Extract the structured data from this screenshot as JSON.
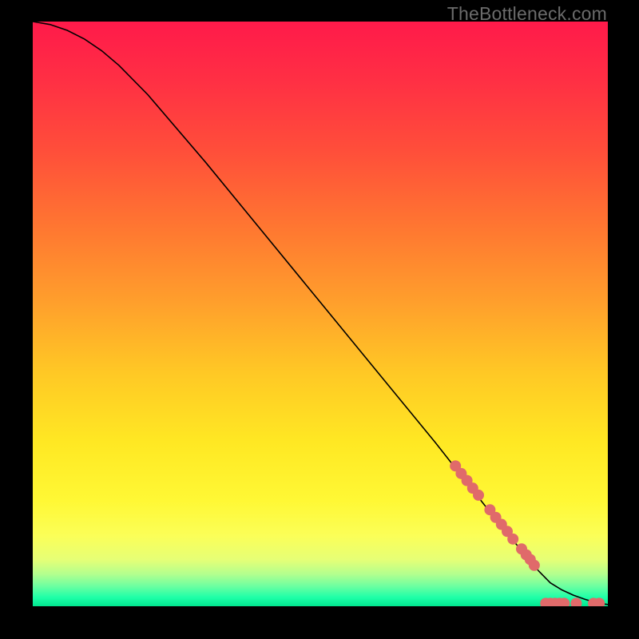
{
  "watermark": "TheBottleneck.com",
  "gradient_stops": [
    {
      "offset": 0.0,
      "color": "#ff1a4a"
    },
    {
      "offset": 0.1,
      "color": "#ff2f44"
    },
    {
      "offset": 0.22,
      "color": "#ff4e3a"
    },
    {
      "offset": 0.35,
      "color": "#ff7631"
    },
    {
      "offset": 0.48,
      "color": "#ff9f2c"
    },
    {
      "offset": 0.6,
      "color": "#ffc825"
    },
    {
      "offset": 0.72,
      "color": "#ffe823"
    },
    {
      "offset": 0.82,
      "color": "#fff835"
    },
    {
      "offset": 0.88,
      "color": "#fbff58"
    },
    {
      "offset": 0.92,
      "color": "#e6ff76"
    },
    {
      "offset": 0.945,
      "color": "#b3ff8e"
    },
    {
      "offset": 0.965,
      "color": "#6fffa0"
    },
    {
      "offset": 0.985,
      "color": "#1effa8"
    },
    {
      "offset": 1.0,
      "color": "#00e68f"
    }
  ],
  "chart_data": {
    "type": "line",
    "title": "",
    "xlabel": "",
    "ylabel": "",
    "xlim": [
      0,
      100
    ],
    "ylim": [
      0,
      100
    ],
    "series": [
      {
        "name": "curve",
        "x": [
          0,
          3,
          6,
          9,
          12,
          15,
          20,
          30,
          40,
          50,
          60,
          70,
          80,
          85,
          88,
          90,
          92,
          94,
          96,
          98,
          100
        ],
        "y": [
          100,
          99.5,
          98.5,
          97,
          95,
          92.5,
          87.5,
          76,
          64,
          52,
          40,
          28,
          15.5,
          9.5,
          6,
          4,
          2.8,
          1.9,
          1.2,
          0.6,
          0.3
        ]
      }
    ],
    "markers": [
      {
        "x": 73.5,
        "y": 24.0
      },
      {
        "x": 74.5,
        "y": 22.7
      },
      {
        "x": 75.5,
        "y": 21.5
      },
      {
        "x": 76.5,
        "y": 20.2
      },
      {
        "x": 77.5,
        "y": 19.0
      },
      {
        "x": 79.5,
        "y": 16.5
      },
      {
        "x": 80.5,
        "y": 15.2
      },
      {
        "x": 81.5,
        "y": 14.0
      },
      {
        "x": 82.5,
        "y": 12.8
      },
      {
        "x": 83.5,
        "y": 11.5
      },
      {
        "x": 85.0,
        "y": 9.8
      },
      {
        "x": 85.8,
        "y": 8.8
      },
      {
        "x": 86.5,
        "y": 8.0
      },
      {
        "x": 87.2,
        "y": 7.0
      },
      {
        "x": 89.2,
        "y": 0.5
      },
      {
        "x": 90.0,
        "y": 0.5
      },
      {
        "x": 90.8,
        "y": 0.5
      },
      {
        "x": 91.6,
        "y": 0.5
      },
      {
        "x": 92.4,
        "y": 0.5
      },
      {
        "x": 94.5,
        "y": 0.5
      },
      {
        "x": 97.5,
        "y": 0.5
      },
      {
        "x": 98.5,
        "y": 0.5
      }
    ],
    "marker_color": "#e06a6a",
    "curve_color": "#000000"
  }
}
